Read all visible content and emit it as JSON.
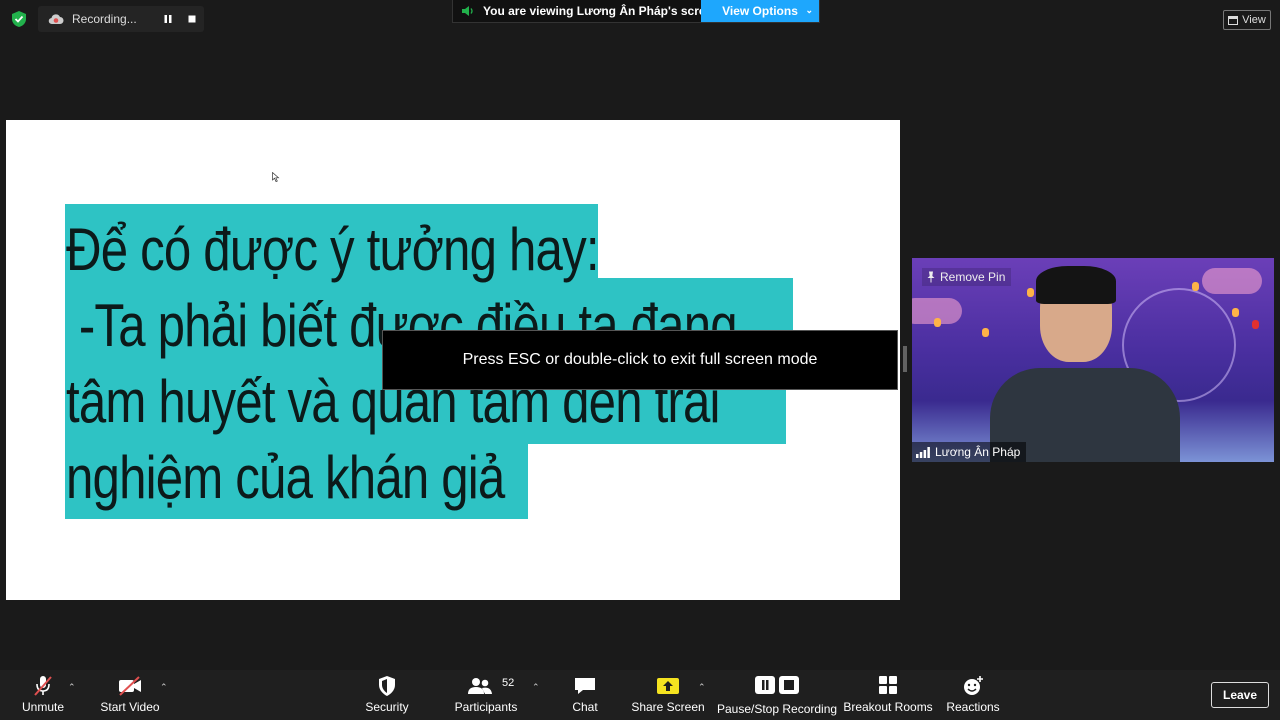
{
  "recording": {
    "label": "Recording..."
  },
  "banner": {
    "viewing_text": "You are viewing Lương Ân Pháp's screen",
    "view_options_label": "View Options"
  },
  "view_button": {
    "label": "View"
  },
  "slide": {
    "lines": [
      "Để có được ý tưởng hay:",
      " -Ta phải biết được điều ta đang",
      "tâm huyết và quan tâm đến trải",
      "nghiệm của khán giả"
    ],
    "highlight_color": "#2ec3c4"
  },
  "toast": {
    "text": "Press ESC or double-click to exit full screen mode"
  },
  "video": {
    "remove_pin_label": "Remove Pin",
    "participant_name": "Lương Ân Pháp"
  },
  "toolbar": {
    "unmute": "Unmute",
    "start_video": "Start Video",
    "security": "Security",
    "participants": "Participants",
    "participants_count": "52",
    "chat": "Chat",
    "share_screen": "Share Screen",
    "recording": "Pause/Stop Recording",
    "breakout": "Breakout Rooms",
    "reactions": "Reactions",
    "leave": "Leave"
  },
  "colors": {
    "accent_blue": "#1ea7fd",
    "share_green": "#f5e320",
    "security_green": "#22b14c",
    "recording_red": "#e05050"
  }
}
